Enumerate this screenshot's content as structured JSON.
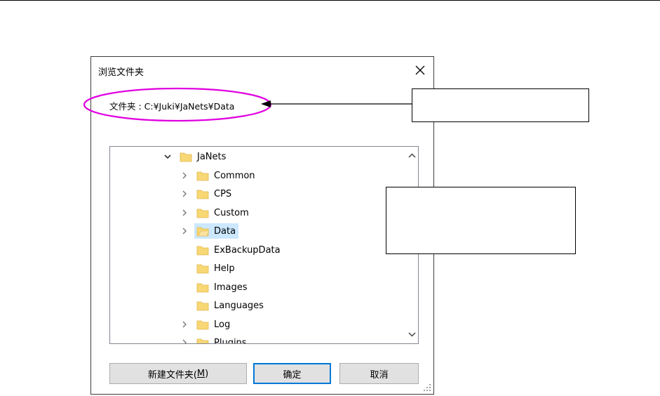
{
  "dialog": {
    "title": "浏览文件夹",
    "folder_label": "文件夹 : C:¥Juki¥JaNets¥Data",
    "tree": {
      "items": [
        {
          "label": "JaNets",
          "expanded": true,
          "has_children": true,
          "selected": false
        },
        {
          "label": "Common",
          "has_children": true,
          "selected": false
        },
        {
          "label": "CPS",
          "has_children": true,
          "selected": false
        },
        {
          "label": "Custom",
          "has_children": true,
          "selected": false
        },
        {
          "label": "Data",
          "has_children": true,
          "selected": true
        },
        {
          "label": "ExBackupData",
          "has_children": false,
          "selected": false
        },
        {
          "label": "Help",
          "has_children": false,
          "selected": false
        },
        {
          "label": "Images",
          "has_children": false,
          "selected": false
        },
        {
          "label": "Languages",
          "has_children": false,
          "selected": false
        },
        {
          "label": "Log",
          "has_children": true,
          "selected": false
        },
        {
          "label": "Plugins",
          "has_children": true,
          "selected": false
        }
      ]
    },
    "buttons": {
      "new_folder_prefix": "新建文件夹(",
      "new_folder_key": "M",
      "new_folder_suffix": ")",
      "ok": "确定",
      "cancel": "取消"
    }
  },
  "colors": {
    "highlight": "#e000e0",
    "selection": "#cce8ff",
    "folder": "#f8d775",
    "default_button_border": "#0078d7"
  },
  "icons": {
    "close": "close-icon",
    "folder": "folder-icon",
    "chevron_right": "chevron-right-icon",
    "chevron_down": "chevron-down-icon"
  }
}
